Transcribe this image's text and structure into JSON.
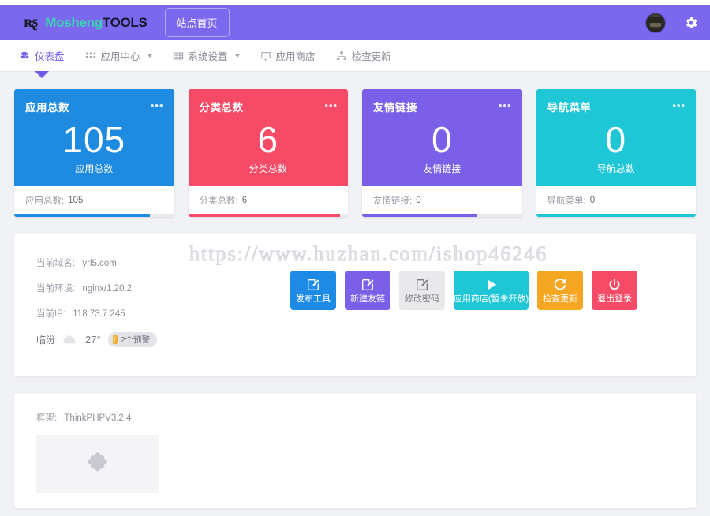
{
  "header": {
    "brand_mark": "ʀʂ",
    "brand_name_1": "Mosheng",
    "brand_name_2": "TOOLS",
    "site_button": "站点首页",
    "avatar_name": "user-avatar",
    "settings_icon": "gear-icon",
    "background": "#7b68ee"
  },
  "nav": {
    "items": [
      {
        "label": "仪表盘",
        "icon": "dashboard-icon",
        "active": true,
        "caret": false
      },
      {
        "label": "应用中心",
        "icon": "grid-icon",
        "active": false,
        "caret": true
      },
      {
        "label": "系统设置",
        "icon": "table-icon",
        "active": false,
        "caret": true
      },
      {
        "label": "应用商店",
        "icon": "monitor-icon",
        "active": false,
        "caret": false
      },
      {
        "label": "检查更新",
        "icon": "sitemap-icon",
        "active": false,
        "caret": false
      }
    ]
  },
  "cards": [
    {
      "title": "应用总数",
      "value": "105",
      "sub": "应用总数",
      "foot_label": "应用总数:",
      "foot_value": "105",
      "color": "#1e8ae0",
      "bar": 85
    },
    {
      "title": "分类总数",
      "value": "6",
      "sub": "分类总数",
      "foot_label": "分类总数:",
      "foot_value": "6",
      "color": "#f54b67",
      "bar": 95
    },
    {
      "title": "友情链接",
      "value": "0",
      "sub": "友情链接",
      "foot_label": "友情链接:",
      "foot_value": "0",
      "color": "#7b5fe8",
      "bar": 72
    },
    {
      "title": "导航菜单",
      "value": "0",
      "sub": "导航总数",
      "foot_label": "导航菜单:",
      "foot_value": "0",
      "color": "#1ec6d6",
      "bar": 100
    }
  ],
  "info": {
    "rows": [
      {
        "label": "当前域名:",
        "value": "yrl5.com"
      },
      {
        "label": "当前环境:",
        "value": "nginx/1.20.2"
      },
      {
        "label": "当前IP:",
        "value": "118.73.7.245"
      }
    ],
    "weather": {
      "city": "临汾",
      "icon": "cloud-icon",
      "temperature": "27°",
      "alert_mark": "!",
      "alert_text": "2个预警"
    }
  },
  "watermark": "https://www.huzhan.com/ishop46246",
  "actions": [
    {
      "label": "发布工具",
      "icon": "edit-square-icon",
      "color": "#1d8ae5",
      "wide": false
    },
    {
      "label": "新建友链",
      "icon": "edit-square-icon",
      "color": "#7b5fe8",
      "wide": false
    },
    {
      "label": "修改密码",
      "icon": "edit-square-icon",
      "color": "#e9e9ec",
      "wide": false
    },
    {
      "label": "应用商店(暂未开放)",
      "icon": "play-icon",
      "color": "#1ec6d6",
      "wide": true
    },
    {
      "label": "检查更新",
      "icon": "refresh-icon",
      "color": "#f5a623",
      "wide": false
    },
    {
      "label": "退出登录",
      "icon": "power-icon",
      "color": "#f54b67",
      "wide": false
    }
  ],
  "framework": {
    "label": "框架:",
    "value": "ThinkPHPV3.2.4",
    "placeholder_icon": "puzzle-piece-icon"
  }
}
